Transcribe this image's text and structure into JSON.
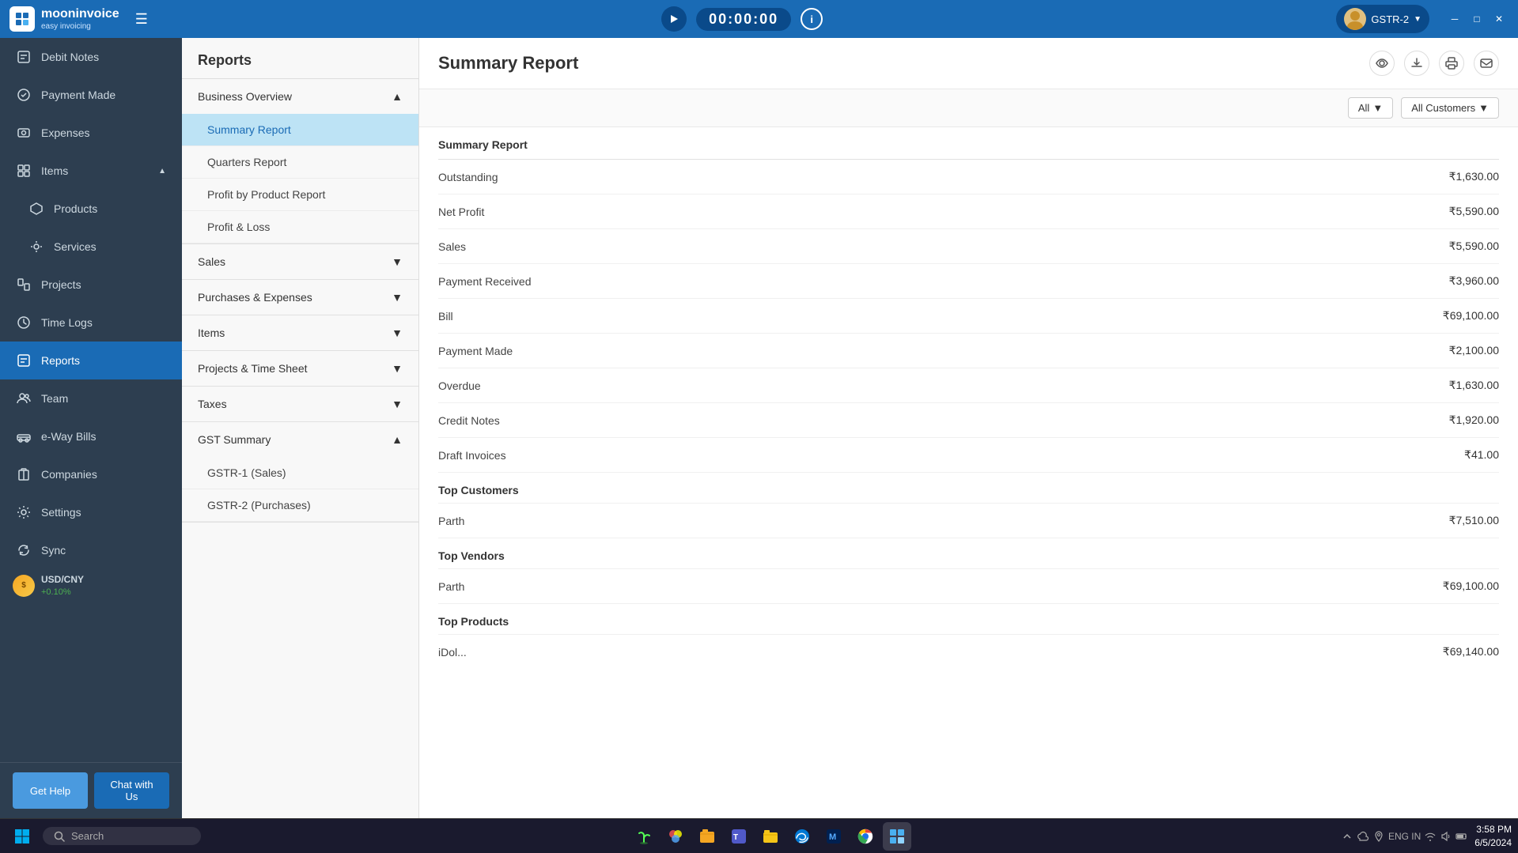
{
  "titleBar": {
    "brand": "mooninvoice",
    "tagline": "easy invoicing",
    "timer": "00:00:00",
    "userName": "GSTR-2",
    "windowButtons": [
      "─",
      "□",
      "✕"
    ]
  },
  "sidebar": {
    "items": [
      {
        "id": "debit-notes",
        "label": "Debit Notes",
        "icon": "debit-icon"
      },
      {
        "id": "payment-made",
        "label": "Payment Made",
        "icon": "payment-icon"
      },
      {
        "id": "expenses",
        "label": "Expenses",
        "icon": "expense-icon"
      },
      {
        "id": "items",
        "label": "Items",
        "icon": "items-icon",
        "expanded": true
      },
      {
        "id": "products",
        "label": "Products",
        "icon": "products-icon"
      },
      {
        "id": "services",
        "label": "Services",
        "icon": "services-icon"
      },
      {
        "id": "projects",
        "label": "Projects",
        "icon": "projects-icon"
      },
      {
        "id": "time-logs",
        "label": "Time Logs",
        "icon": "time-icon"
      },
      {
        "id": "reports",
        "label": "Reports",
        "icon": "reports-icon",
        "active": true
      },
      {
        "id": "team",
        "label": "Team",
        "icon": "team-icon"
      },
      {
        "id": "eway-bills",
        "label": "e-Way Bills",
        "icon": "eway-icon"
      },
      {
        "id": "companies",
        "label": "Companies",
        "icon": "companies-icon"
      },
      {
        "id": "settings",
        "label": "Settings",
        "icon": "settings-icon"
      },
      {
        "id": "sync",
        "label": "Sync",
        "icon": "sync-icon"
      }
    ],
    "currency": {
      "pair": "USD/CNY",
      "change": "+0.10%"
    },
    "buttons": {
      "help": "Get Help",
      "chat": "Chat with Us"
    }
  },
  "reportsPanel": {
    "title": "Reports",
    "sections": [
      {
        "id": "business-overview",
        "label": "Business Overview",
        "expanded": true,
        "items": [
          {
            "id": "summary-report",
            "label": "Summary Report",
            "active": true
          },
          {
            "id": "quarters-report",
            "label": "Quarters Report"
          },
          {
            "id": "profit-product",
            "label": "Profit by Product Report"
          },
          {
            "id": "profit-loss",
            "label": "Profit & Loss"
          }
        ]
      },
      {
        "id": "sales",
        "label": "Sales",
        "expanded": false,
        "items": []
      },
      {
        "id": "purchases-expenses",
        "label": "Purchases & Expenses",
        "expanded": false,
        "items": []
      },
      {
        "id": "items-section",
        "label": "Items",
        "expanded": false,
        "items": []
      },
      {
        "id": "projects-timesheet",
        "label": "Projects & Time Sheet",
        "expanded": false,
        "items": []
      },
      {
        "id": "taxes",
        "label": "Taxes",
        "expanded": false,
        "items": []
      },
      {
        "id": "gst-summary",
        "label": "GST Summary",
        "expanded": true,
        "items": [
          {
            "id": "gstr1",
            "label": "GSTR-1 (Sales)"
          },
          {
            "id": "gstr2",
            "label": "GSTR-2 (Purchases)"
          }
        ]
      }
    ]
  },
  "mainContent": {
    "title": "Summary Report",
    "filters": {
      "period": "All",
      "customer": "All Customers"
    },
    "reportTitle": "Summary Report",
    "rows": [
      {
        "label": "Outstanding",
        "value": "₹1,630.00",
        "bold": false
      },
      {
        "label": "Net Profit",
        "value": "₹5,590.00",
        "bold": false
      },
      {
        "label": "Sales",
        "value": "₹5,590.00",
        "bold": false
      },
      {
        "label": "Payment Received",
        "value": "₹3,960.00",
        "bold": false
      },
      {
        "label": "Bill",
        "value": "₹69,100.00",
        "bold": false
      },
      {
        "label": "Payment Made",
        "value": "₹2,100.00",
        "bold": false
      },
      {
        "label": "Overdue",
        "value": "₹1,630.00",
        "bold": false
      },
      {
        "label": "Credit Notes",
        "value": "₹1,920.00",
        "bold": false
      },
      {
        "label": "Draft Invoices",
        "value": "₹41.00",
        "bold": false
      }
    ],
    "sections": [
      {
        "title": "Top Customers",
        "rows": [
          {
            "label": "Parth",
            "value": "₹7,510.00"
          }
        ]
      },
      {
        "title": "Top Vendors",
        "rows": [
          {
            "label": "Parth",
            "value": "₹69,100.00"
          }
        ]
      },
      {
        "title": "Top Products",
        "rows": [
          {
            "label": "iDol...",
            "value": "₹69,140.00"
          }
        ]
      }
    ]
  },
  "taskbar": {
    "searchPlaceholder": "Search",
    "clock": "3:58 PM\n6/5/2024",
    "lang": "ENG\nIN"
  }
}
